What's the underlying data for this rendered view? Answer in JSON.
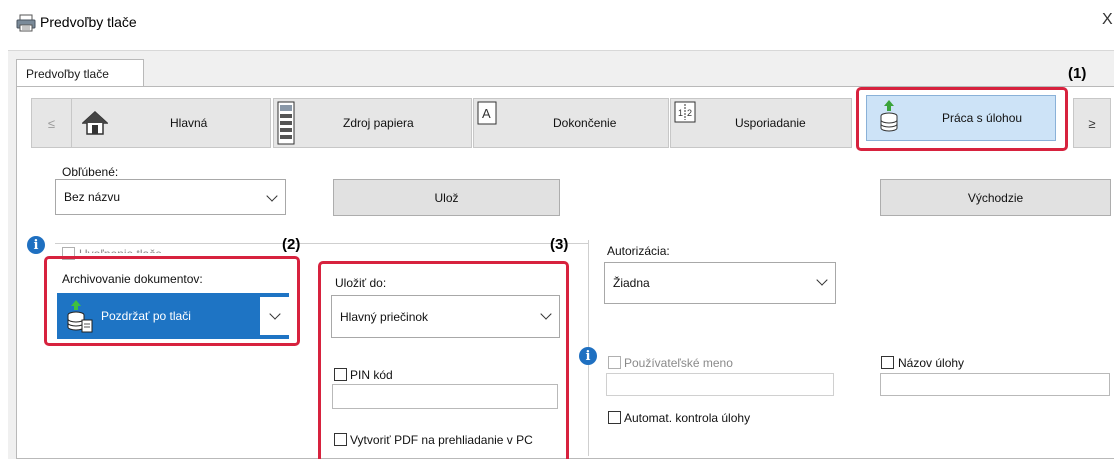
{
  "window": {
    "title": "Predvoľby tlače",
    "close_glyph": "X"
  },
  "tab": {
    "label": "Predvoľby tlače"
  },
  "nav": {
    "prev_label": "≤",
    "next_label": "≥",
    "items": [
      {
        "label": "Hlavná",
        "icon": "home-icon"
      },
      {
        "label": "Zdroj papiera",
        "icon": "paper-tray-icon"
      },
      {
        "label": "Dokončenie",
        "icon": "finishing-icon"
      },
      {
        "label": "Usporiadanie",
        "icon": "layout-icon"
      },
      {
        "label": "Práca s úlohou",
        "icon": "job-storage-icon",
        "selected": true
      }
    ]
  },
  "favorites": {
    "label": "Obľúbené:",
    "value": "Bez názvu",
    "save_label": "Ulož",
    "default_label": "Východzie"
  },
  "release": {
    "label": "Uvoľnenie tlače",
    "checked": false
  },
  "archiving": {
    "label": "Archivovanie dokumentov:",
    "value": "Pozdržať po tlači"
  },
  "save_to": {
    "label": "Uložiť do:",
    "value": "Hlavný priečinok",
    "pin_label": "PIN kód",
    "pin_value": "",
    "pdf_label": "Vytvoriť PDF na prehliadanie v PC"
  },
  "authorization": {
    "label": "Autorizácia:",
    "value": "Žiadna",
    "username_label": "Používateľské meno",
    "username_value": "",
    "jobname_label": "Názov úlohy",
    "jobname_value": "",
    "auto_check_label": "Automat. kontrola úlohy"
  },
  "callouts": {
    "one": "(1)",
    "two": "(2)",
    "three": "(3)"
  },
  "colors": {
    "callout": "#d7223e",
    "selected_bg": "#cde3f7",
    "archive_bg": "#1e74c4",
    "info_blue": "#1f70c1"
  }
}
